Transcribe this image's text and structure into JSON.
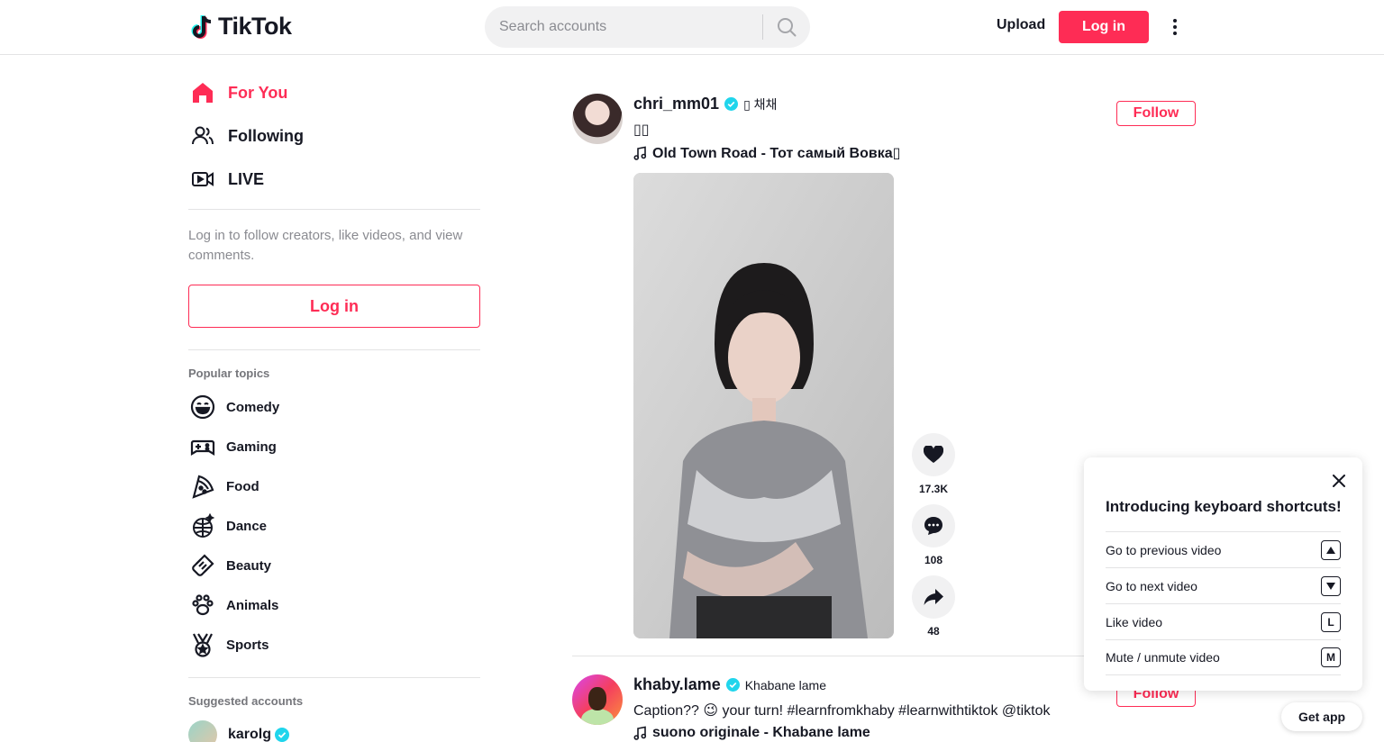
{
  "header": {
    "logo_text": "TikTok",
    "search_placeholder": "Search accounts",
    "upload_label": "Upload",
    "login_label": "Log in"
  },
  "sidebar": {
    "nav": [
      {
        "label": "For You",
        "icon": "home-icon"
      },
      {
        "label": "Following",
        "icon": "users-icon"
      },
      {
        "label": "LIVE",
        "icon": "live-icon"
      }
    ],
    "login_hint": "Log in to follow creators, like videos, and view comments.",
    "login_label": "Log in",
    "popular_topics_title": "Popular topics",
    "topics": [
      {
        "label": "Comedy",
        "icon": "smile-icon"
      },
      {
        "label": "Gaming",
        "icon": "gamepad-icon"
      },
      {
        "label": "Food",
        "icon": "pizza-icon"
      },
      {
        "label": "Dance",
        "icon": "disco-ball-icon"
      },
      {
        "label": "Beauty",
        "icon": "comb-icon"
      },
      {
        "label": "Animals",
        "icon": "paw-icon"
      },
      {
        "label": "Sports",
        "icon": "medal-icon"
      }
    ],
    "suggested_title": "Suggested accounts",
    "suggested": [
      {
        "name": "karolg"
      }
    ]
  },
  "feed": {
    "posts": [
      {
        "username": "chri_mm01",
        "nickname": "▯ 채채",
        "caption": "▯▯",
        "music": "Old Town Road - Тот самый Вовка▯",
        "follow_label": "Follow",
        "likes": "17.3K",
        "comments": "108",
        "shares": "48"
      },
      {
        "username": "khaby.lame",
        "nickname": "Khabane lame",
        "caption": "Caption?? 😉 your turn! #learnfromkhaby #learnwithtiktok @tiktok",
        "music": "suono originale - Khabane lame",
        "follow_label": "Follow"
      }
    ]
  },
  "shortcuts_popup": {
    "title": "Introducing keyboard shortcuts!",
    "items": [
      {
        "label": "Go to previous video",
        "key": "▲"
      },
      {
        "label": "Go to next video",
        "key": "▼"
      },
      {
        "label": "Like video",
        "key": "L"
      },
      {
        "label": "Mute / unmute video",
        "key": "M"
      }
    ]
  },
  "get_app_label": "Get app",
  "colors": {
    "accent": "#fe2c55",
    "text": "#161823",
    "muted": "#8a8b91",
    "verified": "#20d5ec"
  }
}
